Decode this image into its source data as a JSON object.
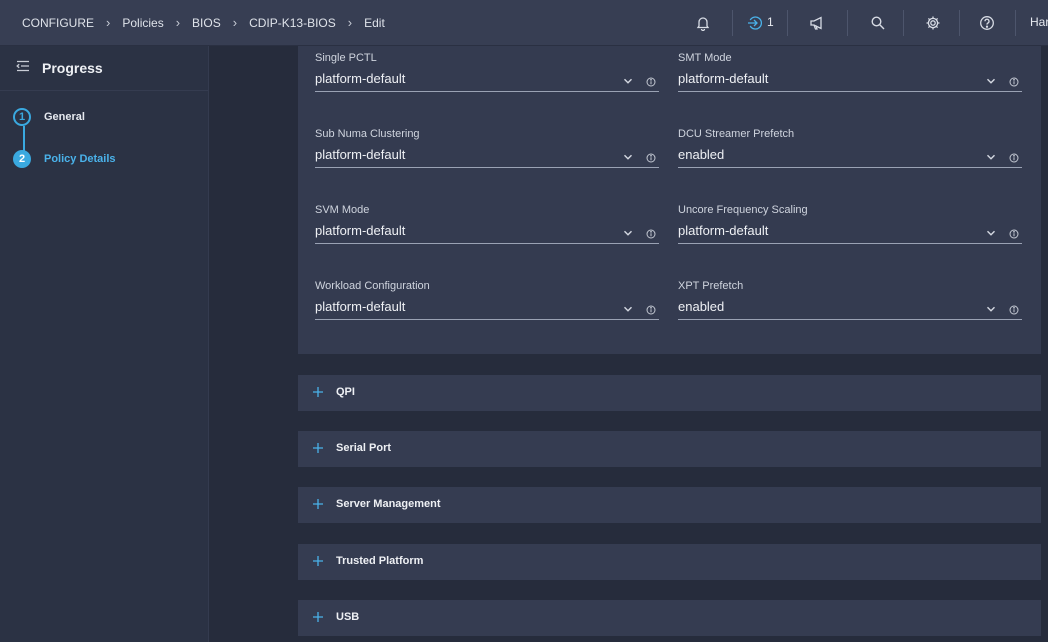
{
  "breadcrumb": [
    "CONFIGURE",
    "Policies",
    "BIOS",
    "CDIP-K13-BIOS",
    "Edit"
  ],
  "header": {
    "notification_count": "1",
    "user": "Har",
    "icons": [
      "bell-icon",
      "login-requests-icon",
      "megaphone-icon",
      "search-icon",
      "gear-icon",
      "help-icon"
    ]
  },
  "sidebar": {
    "title": "Progress",
    "steps": [
      {
        "number": "1",
        "label": "General",
        "state": "completed"
      },
      {
        "number": "2",
        "label": "Policy Details",
        "state": "active"
      }
    ]
  },
  "fields": [
    {
      "label": "Single PCTL",
      "value": "platform-default"
    },
    {
      "label": "SMT Mode",
      "value": "platform-default"
    },
    {
      "label": "Sub Numa Clustering",
      "value": "platform-default"
    },
    {
      "label": "DCU Streamer Prefetch",
      "value": "enabled"
    },
    {
      "label": "SVM Mode",
      "value": "platform-default"
    },
    {
      "label": "Uncore Frequency Scaling",
      "value": "platform-default"
    },
    {
      "label": "Workload Configuration",
      "value": "platform-default"
    },
    {
      "label": "XPT Prefetch",
      "value": "enabled"
    }
  ],
  "sections": [
    "QPI",
    "Serial Port",
    "Server Management",
    "Trusted Platform",
    "USB"
  ],
  "colors": {
    "accent": "#3aa9e0",
    "background": "#262c3c",
    "panel": "#343b50",
    "topbar": "#373e53"
  }
}
